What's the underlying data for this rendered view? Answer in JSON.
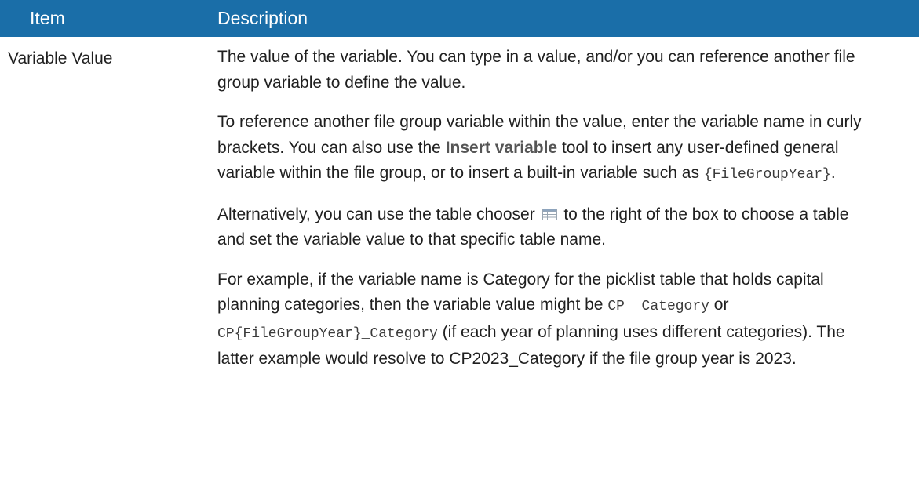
{
  "table": {
    "header": {
      "item": "Item",
      "description": "Description"
    },
    "row": {
      "item": "Variable Value",
      "p1": "The value of the variable. You can type in a value, and/or you can reference another file group variable to define the value.",
      "p2": {
        "a": "To reference another file group variable within the value, enter the variable name in curly brackets. You can also use the ",
        "b": "Insert variable",
        "c": " tool to insert any user-defined general variable within the file group, or to insert a built-in variable such as ",
        "d": "{FileGroupYear}",
        "e": "."
      },
      "p3": {
        "a": "Alternatively, you can use the table chooser ",
        "icon": "table-chooser-icon",
        "b": " to the right of the box to choose a table and set the variable value to that specific table name."
      },
      "p4": {
        "a": "For example, if the variable name is Category for the picklist table that holds capital planning categories, then the variable value might be ",
        "b": "CP_ Category",
        "c": " or ",
        "d": "CP{FileGroupYear}_Category",
        "e": " (if each year of planning uses different categories). The latter example would resolve to CP2023_Category if the file group year is 2023."
      }
    }
  },
  "colors": {
    "header_bg": "#1a6ea8",
    "header_text": "#ffffff"
  }
}
